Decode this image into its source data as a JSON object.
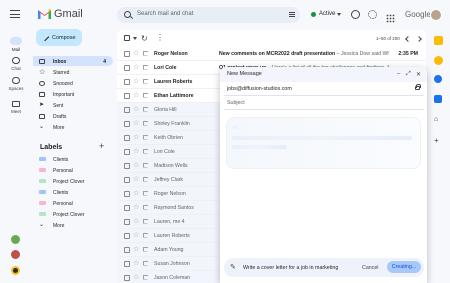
{
  "app": {
    "name": "Gmail"
  },
  "search": {
    "placeholder": "Search mail and chat"
  },
  "status": {
    "label": "Active"
  },
  "brand": {
    "google": "Google"
  },
  "rail": {
    "mail": "Mail",
    "chat": "Chat",
    "spaces": "Spaces",
    "meet": "Meet"
  },
  "compose_label": "Compose",
  "nav": [
    {
      "label": "Inbox",
      "count": "4"
    },
    {
      "label": "Starred"
    },
    {
      "label": "Snoozed"
    },
    {
      "label": "Important"
    },
    {
      "label": "Sent"
    },
    {
      "label": "Drafts"
    },
    {
      "label": "More"
    }
  ],
  "labels": {
    "title": "Labels",
    "items": [
      {
        "label": "Clients",
        "color": "#a0c4ff"
      },
      {
        "label": "Personal",
        "color": "#f7b6d2"
      },
      {
        "label": "Project Clover",
        "color": "#b7e4c7"
      },
      {
        "label": "Clients",
        "color": "#a0c4ff"
      },
      {
        "label": "Personal",
        "color": "#f7b6d2"
      },
      {
        "label": "Project Clover",
        "color": "#b7e4c7"
      },
      {
        "label": "More"
      }
    ]
  },
  "pager": "1–50 of 200",
  "emails": [
    {
      "sender": "Roger Nelson",
      "subject": "New comments on MCR2022 draft presentation",
      "snippet": " – Jessica Dow said What a...",
      "time": "2:35 PM",
      "unread": true
    },
    {
      "sender": "Lori Cole",
      "subject": "Q1 project wrap-up",
      "snippet": " – Here's a list of all the top challenges and findings. Sur...",
      "time": "",
      "unread": true
    },
    {
      "sender": "Lauren Roberts",
      "subject": "",
      "snippet": "",
      "time": "",
      "unread": true
    },
    {
      "sender": "Ethan Lattimore",
      "subject": "",
      "snippet": "",
      "time": "",
      "unread": true
    },
    {
      "sender": "Gloria Hill",
      "unread": false
    },
    {
      "sender": "Shirley Franklin",
      "unread": false
    },
    {
      "sender": "Keith Obrien",
      "unread": false
    },
    {
      "sender": "Lori Cole",
      "unread": false
    },
    {
      "sender": "Madison Wells",
      "unread": false
    },
    {
      "sender": "Jeffrey Clark",
      "unread": false
    },
    {
      "sender": "Roger Nelson",
      "unread": false
    },
    {
      "sender": "Raymond Santos",
      "unread": false
    },
    {
      "sender": "Lauren, me  4",
      "unread": false
    },
    {
      "sender": "Lauren Roberts",
      "unread": false
    },
    {
      "sender": "Adam Young",
      "unread": false
    },
    {
      "sender": "Susan Johnson",
      "unread": false
    },
    {
      "sender": "Jason Coleman",
      "unread": false
    }
  ],
  "compose_window": {
    "title": "New Message",
    "to": "jobs@diffusion-studios.com",
    "subject_placeholder": "Subject",
    "prompt": "Write a cover letter for a job in marketing",
    "cancel": "Cancel",
    "creating": "Creating..."
  },
  "colors": {
    "accent": "#0b57d0",
    "compose_bg": "#c2e7ff",
    "active_nav": "#d3e3fd"
  }
}
